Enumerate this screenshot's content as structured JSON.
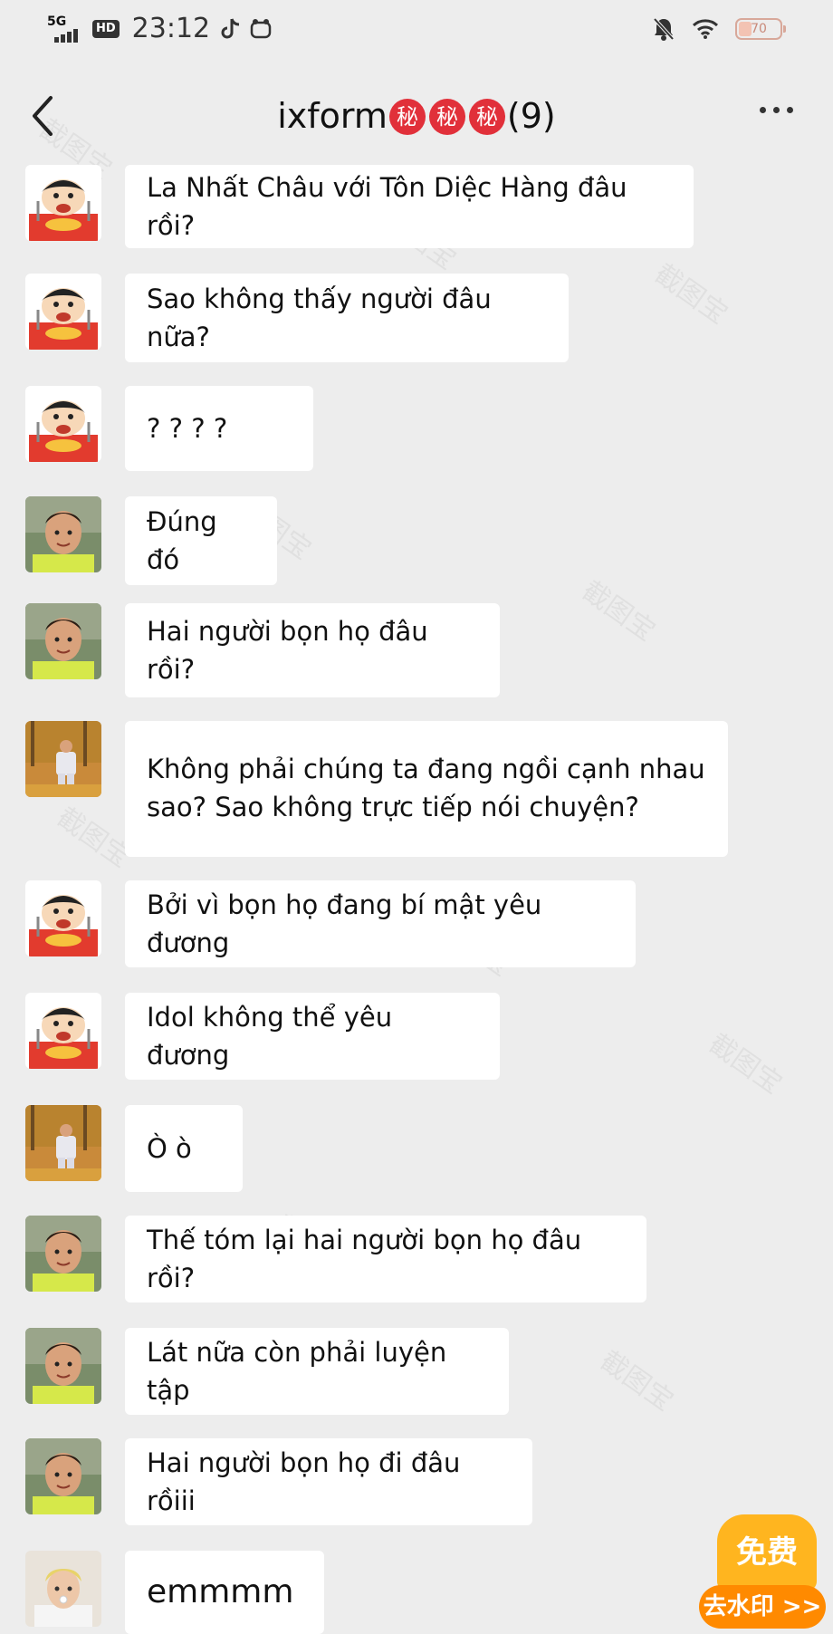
{
  "status": {
    "network": "5G",
    "hd": "HD",
    "time": "23:12",
    "battery": "70"
  },
  "chat": {
    "title": "ixform",
    "badge_char": "秘",
    "member_count": "(9)"
  },
  "messages": [
    {
      "avatar": "cartoon-boy",
      "text": "La Nhất Châu với Tôn Diệc Hàng đâu rồi?"
    },
    {
      "avatar": "cartoon-boy",
      "text": "Sao không thấy người đâu nữa?"
    },
    {
      "avatar": "cartoon-boy",
      "text": "? ? ? ?"
    },
    {
      "avatar": "child-photo",
      "text": "Đúng đó"
    },
    {
      "avatar": "child-photo",
      "text": "Hai người bọn họ đâu rồi?"
    },
    {
      "avatar": "autumn-photo",
      "text": "Không phải chúng ta đang ngồi cạnh nhau sao? Sao không trực tiếp nói chuyện?"
    },
    {
      "avatar": "cartoon-boy",
      "text": "Bởi vì bọn họ đang bí mật yêu đương"
    },
    {
      "avatar": "cartoon-boy",
      "text": "Idol không thể yêu đương"
    },
    {
      "avatar": "autumn-photo",
      "text": "Ò ò"
    },
    {
      "avatar": "child-photo",
      "text": "Thế tóm lại hai người bọn họ đâu rồi?"
    },
    {
      "avatar": "child-photo",
      "text": "Lát nữa còn phải luyện tập"
    },
    {
      "avatar": "child-photo",
      "text": "Hai người bọn họ đi đâu rồiii"
    },
    {
      "avatar": "young-man-photo",
      "text": "emmmm"
    }
  ],
  "promo": {
    "line1": "免费",
    "line2": "去水印 >>"
  },
  "watermark": "截图宝"
}
